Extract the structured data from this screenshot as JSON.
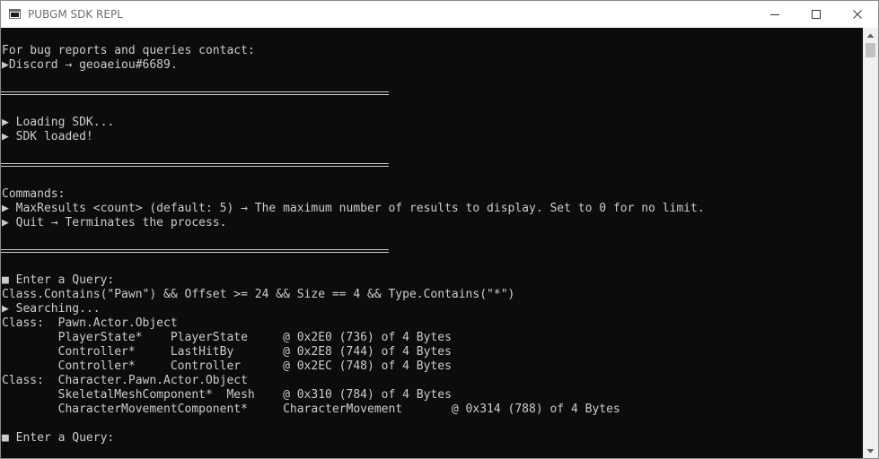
{
  "window": {
    "title": "PUBGM SDK REPL"
  },
  "console": {
    "lines": [
      "For bug reports and queries contact:",
      "▶Discord → geoaeiou#6689.",
      "▶ Loading SDK...",
      "▶ SDK loaded!",
      "Commands:",
      "▶ MaxResults <count> (default: 5) → The maximum number of results to display. Set to 0 for no limit.",
      "▶ Quit → Terminates the process.",
      "■ Enter a Query:",
      "Class.Contains(\"Pawn\") && Offset >= 24 && Size == 4 && Type.Contains(\"*\")",
      "▶ Searching...",
      "Class:  Pawn.Actor.Object",
      "        PlayerState*    PlayerState     @ 0x2E0 (736) of 4 Bytes",
      "        Controller*     LastHitBy       @ 0x2E8 (744) of 4 Bytes",
      "        Controller*     Controller      @ 0x2EC (748) of 4 Bytes",
      "Class:  Character.Pawn.Actor.Object",
      "        SkeletalMeshComponent*  Mesh    @ 0x310 (784) of 4 Bytes",
      "        CharacterMovementComponent*     CharacterMovement       @ 0x314 (788) of 4 Bytes",
      "■ Enter a Query:"
    ]
  },
  "colors": {
    "console_bg": "#0c0c0c",
    "console_text": "#cccccc",
    "titlebar_bg": "#ffffff"
  }
}
